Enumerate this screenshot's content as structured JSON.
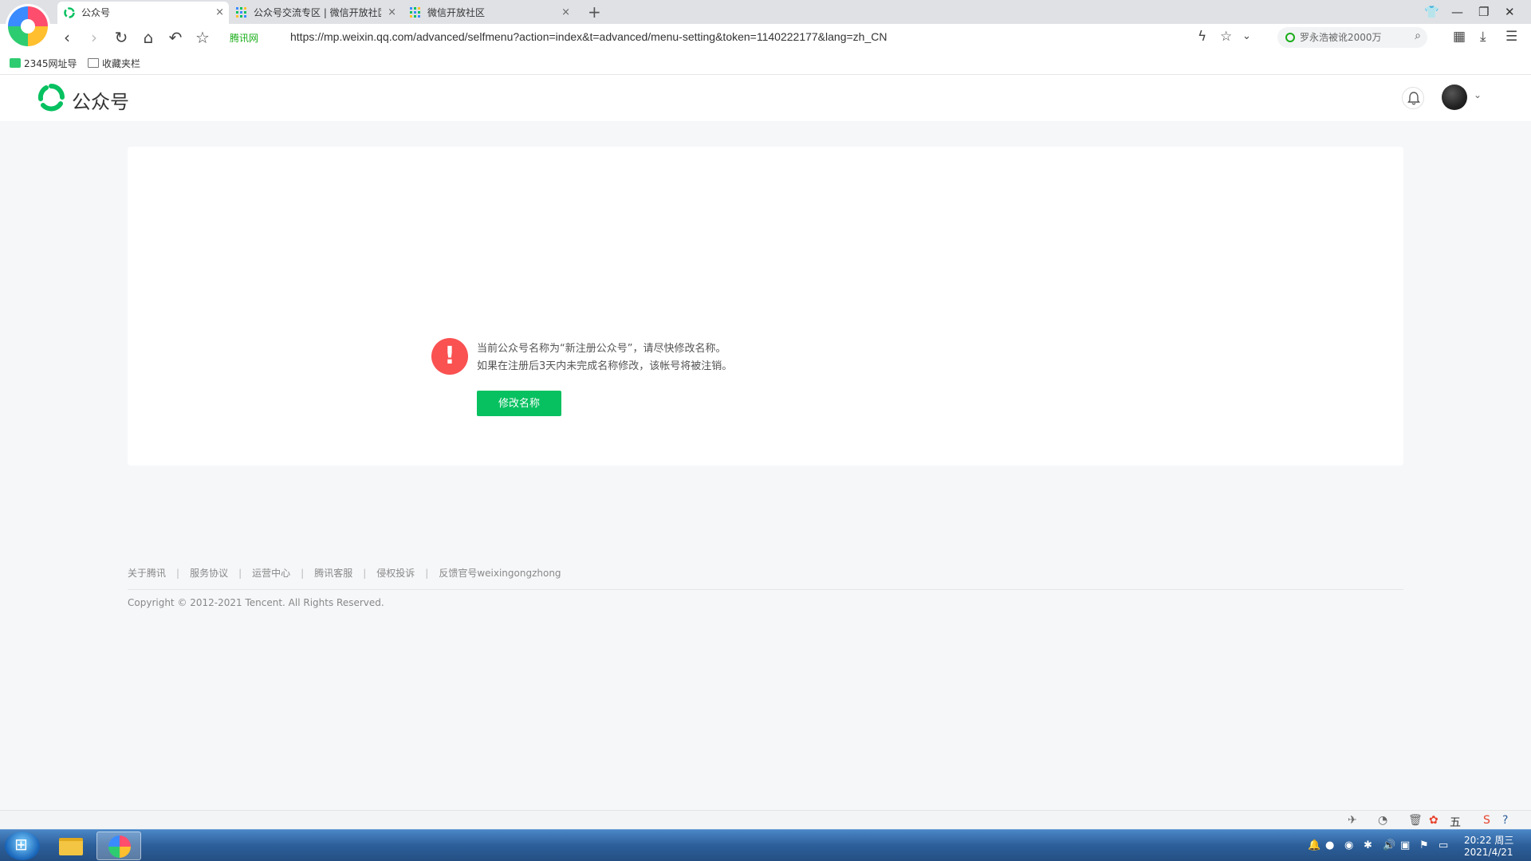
{
  "browser": {
    "tabs": [
      {
        "label": "公众号",
        "active": true
      },
      {
        "label": "公众号交流专区 | 微信开放社区",
        "active": false
      },
      {
        "label": "微信开放社区",
        "active": false
      }
    ],
    "new_tab": "+",
    "secure_label": "腾讯网",
    "url": "https://mp.weixin.qq.com/advanced/selfmenu?action=index&t=advanced/menu-setting&token=1140222177&lang=zh_CN",
    "search_placeholder": "罗永浩被讹2000万",
    "bookmarks": [
      {
        "label": "2345网址导"
      },
      {
        "label": "收藏夹栏"
      }
    ]
  },
  "site": {
    "logo_text": "公众号",
    "brand_color": "#07c160"
  },
  "notice": {
    "line1": "当前公众号名称为“新注册公众号”，请尽快修改名称。",
    "line2": "如果在注册后3天内未完成名称修改，该帐号将被注销。",
    "button_label": "修改名称",
    "icon": "exclamation-icon",
    "icon_color": "#fa5151"
  },
  "footer": {
    "links": [
      "关于腾讯",
      "服务协议",
      "运营中心",
      "腾讯客服",
      "侵权投诉",
      "反馈官号weixingongzhong"
    ],
    "copyright": "Copyright © 2012-2021 Tencent. All Rights Reserved."
  },
  "taskbar": {
    "time": "20:22 周三",
    "date": "2021/4/21",
    "ime": "五"
  }
}
